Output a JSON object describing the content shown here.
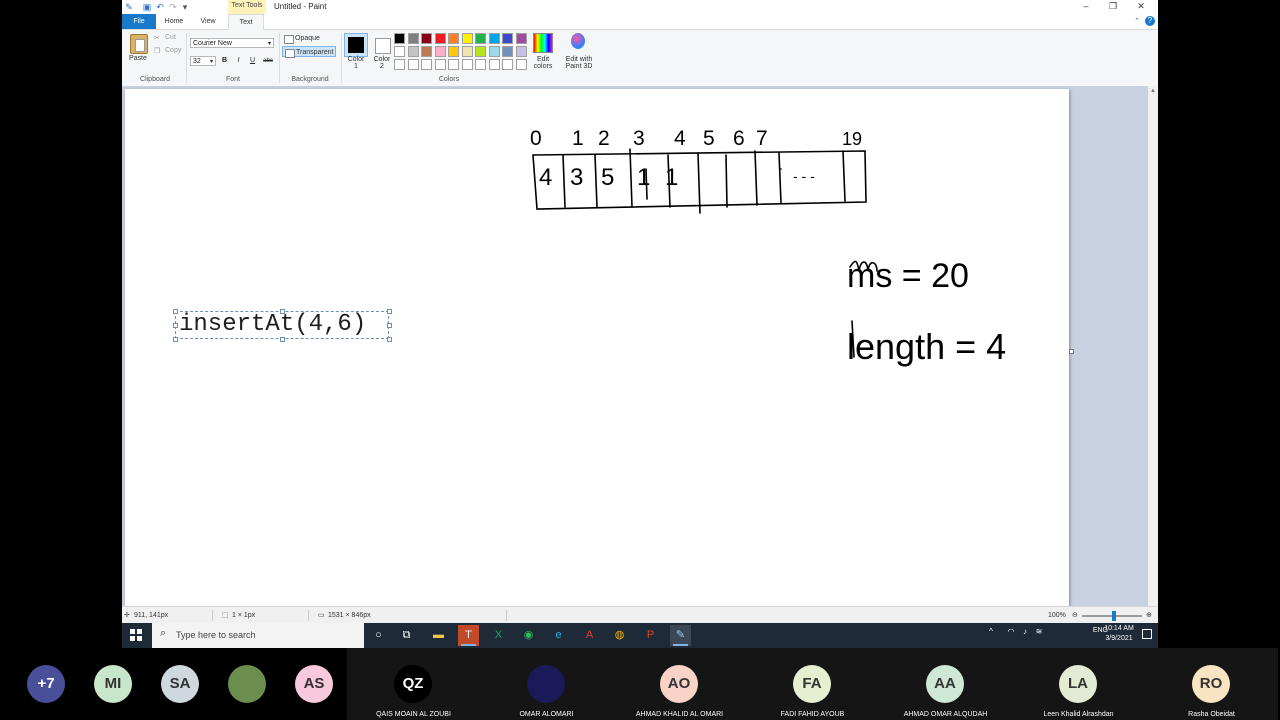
{
  "window": {
    "title": "Untitled - Paint",
    "context_tab": "Text Tools",
    "min_glyph": "–",
    "restore_glyph": "❐",
    "close_glyph": "✕"
  },
  "tabs": {
    "file": "File",
    "home": "Home",
    "view": "View",
    "text": "Text",
    "help": "?",
    "collapse": "⌃"
  },
  "ribbon": {
    "clipboard": {
      "paste": "Paste",
      "cut": "Cut",
      "copy": "Copy",
      "label": "Clipboard"
    },
    "font": {
      "family": "Courier New",
      "size": "32",
      "bold": "B",
      "italic": "I",
      "underline": "U",
      "strike": "abc",
      "label": "Font"
    },
    "background": {
      "opaque": "Opaque",
      "transparent": "Transparent",
      "label": "Background"
    },
    "colors": {
      "color1_line1": "Color",
      "color1_line2": "1",
      "color2_line1": "Color",
      "color2_line2": "2",
      "edit_line1": "Edit",
      "edit_line2": "colors",
      "paint3d_line1": "Edit with",
      "paint3d_line2": "Paint 3D",
      "label": "Colors",
      "color1": "#000000",
      "color2": "#ffffff",
      "palette_row1": [
        "#000000",
        "#7f7f7f",
        "#880015",
        "#ed1c24",
        "#ff7f27",
        "#fff200",
        "#22b14c",
        "#00a2e8",
        "#3f48cc",
        "#a349a4"
      ],
      "palette_row2": [
        "#ffffff",
        "#c3c3c3",
        "#b97a57",
        "#ffaec9",
        "#ffc90e",
        "#efe4b0",
        "#b5e61d",
        "#99d9ea",
        "#7092be",
        "#c8bfe7"
      ],
      "palette_row3": [
        "#ffffff",
        "#ffffff",
        "#ffffff",
        "#ffffff",
        "#ffffff",
        "#ffffff",
        "#ffffff",
        "#ffffff",
        "#ffffff",
        "#ffffff"
      ]
    }
  },
  "canvas": {
    "text_box": "insertAt(4,6)",
    "handwriting": {
      "indices": [
        "0",
        "1",
        "2",
        "3",
        "4",
        "5",
        "6",
        "7",
        "19"
      ],
      "cells": [
        "4",
        "3",
        "5",
        "1",
        "1"
      ],
      "ellipsis": "- - -",
      "ms_note": "ms = 20",
      "length_note": "length = 4"
    }
  },
  "statusbar": {
    "cursor": "911, 141px",
    "selection": "1 × 1px",
    "size": "1531 × 846px",
    "zoom": "100%"
  },
  "taskbar": {
    "search_placeholder": "Type here to search",
    "tray_lang": "ENG",
    "time": "10:14 AM",
    "date": "3/9/2021"
  },
  "participants": [
    {
      "initials": "+7",
      "name": "",
      "bg": "#4a4f9a",
      "fg": "#ffffff"
    },
    {
      "initials": "MI",
      "name": "",
      "bg": "#c8e6c9",
      "fg": "#333333"
    },
    {
      "initials": "SA",
      "name": "",
      "bg": "#cfd8dc",
      "fg": "#333333"
    },
    {
      "initials": "",
      "name": "",
      "bg": "#6b8e4e",
      "fg": "#ffffff"
    },
    {
      "initials": "AS",
      "name": "",
      "bg": "#f8c8dc",
      "fg": "#333333"
    },
    {
      "initials": "QZ",
      "name": "QAIS MOAIN AL ZOUBI",
      "bg": "#000000",
      "fg": "#ffffff"
    },
    {
      "initials": "",
      "name": "OMAR ALOMARI",
      "bg": "#1a1a5a",
      "fg": "#ffffff"
    },
    {
      "initials": "AO",
      "name": "AHMAD KHALID AL OMARI",
      "bg": "#f9d3c8",
      "fg": "#333333"
    },
    {
      "initials": "FA",
      "name": "FADI FAHID AYOUB",
      "bg": "#e6efcf",
      "fg": "#333333"
    },
    {
      "initials": "AA",
      "name": "AHMAD OMAR ALQUDAH",
      "bg": "#cfe8d6",
      "fg": "#333333"
    },
    {
      "initials": "LA",
      "name": "Leen Khalid Alrashdan",
      "bg": "#e3ebd5",
      "fg": "#333333"
    },
    {
      "initials": "RO",
      "name": "Rasha Obeidat",
      "bg": "#f8e3c3",
      "fg": "#333333"
    }
  ]
}
